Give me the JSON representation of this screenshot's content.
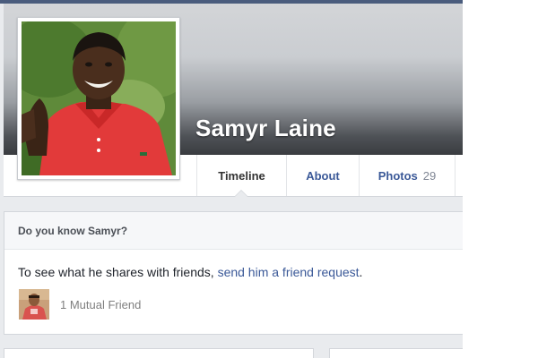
{
  "profile": {
    "name": "Samyr Laine"
  },
  "nav": {
    "tabs": [
      {
        "label": "Timeline"
      },
      {
        "label": "About"
      },
      {
        "label": "Photos",
        "count": "29"
      }
    ]
  },
  "friend_card": {
    "heading": "Do you know Samyr?",
    "message_prefix": "To see what he shares with friends, ",
    "message_link": "send him a friend request",
    "message_suffix": ".",
    "mutual_friends": "1 Mutual Friend"
  },
  "colors": {
    "link": "#3b5998",
    "page_bg": "#e9ebee",
    "nav_text_active": "#333333"
  },
  "icons": {
    "profile_picture": "person-in-red-polo-photo",
    "mutual_friend_avatar": "friend-avatar-photo"
  }
}
